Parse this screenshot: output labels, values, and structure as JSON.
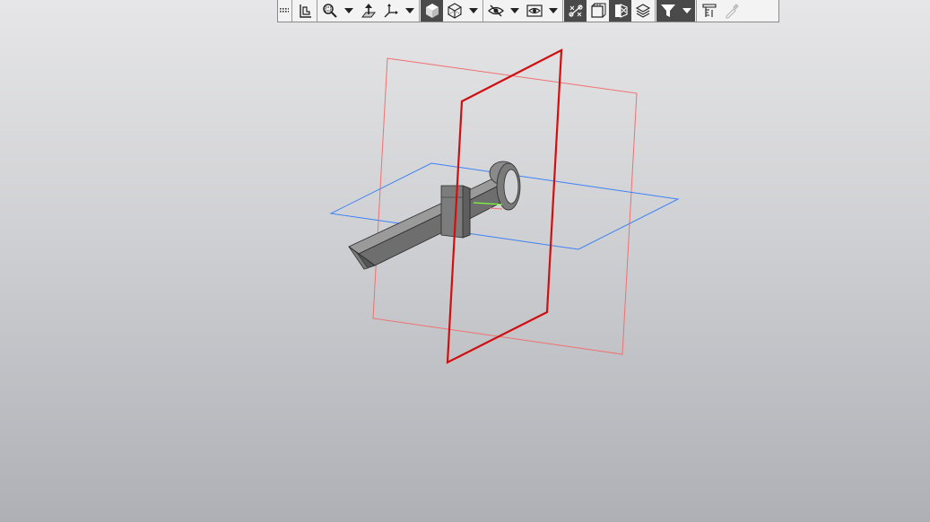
{
  "toolbar": {
    "buttons": [
      {
        "name": "toolbar-grip",
        "icon": "grip-dots-icon"
      },
      {
        "name": "orientation-button",
        "icon": "orientation-icon"
      },
      {
        "name": "zoom-button",
        "icon": "zoom-window-icon"
      },
      {
        "name": "zoom-dropdown",
        "icon": "chevron-down-icon"
      },
      {
        "name": "normal-to-button",
        "icon": "normal-to-icon"
      },
      {
        "name": "view-orientation-button",
        "icon": "axes-icon"
      },
      {
        "name": "view-orientation-dropdown",
        "icon": "chevron-down-icon"
      },
      {
        "name": "shaded-display-button",
        "icon": "shaded-cube-icon",
        "active": true
      },
      {
        "name": "wireframe-display-button",
        "icon": "wireframe-cube-icon"
      },
      {
        "name": "display-mode-dropdown",
        "icon": "chevron-down-icon"
      },
      {
        "name": "hide-button",
        "icon": "hide-eye-icon"
      },
      {
        "name": "hide-dropdown",
        "icon": "chevron-down-icon"
      },
      {
        "name": "show-hidden-button",
        "icon": "show-eye-icon"
      },
      {
        "name": "show-hidden-dropdown",
        "icon": "chevron-down-icon"
      },
      {
        "name": "show-constraints-button",
        "icon": "constraints-icon",
        "active": true
      },
      {
        "name": "section-view-button",
        "icon": "section-view-icon"
      },
      {
        "name": "perspective-button",
        "icon": "perspective-icon",
        "active": true
      },
      {
        "name": "layers-button",
        "icon": "layers-icon"
      },
      {
        "name": "filter-button",
        "icon": "filter-icon",
        "active": true
      },
      {
        "name": "filter-dropdown",
        "icon": "chevron-down-icon",
        "active": true
      },
      {
        "name": "measure-button",
        "icon": "measure-icon"
      },
      {
        "name": "eyedropper-button",
        "icon": "eyedropper-icon",
        "disabled": true
      }
    ]
  },
  "viewport": {
    "plane_colors": {
      "front_plane": "#d01010",
      "side_plane": "#f07070",
      "top_plane": "#3b82f6",
      "part_body": "#7d7d7d",
      "part_edge": "#2b2b2b"
    }
  }
}
